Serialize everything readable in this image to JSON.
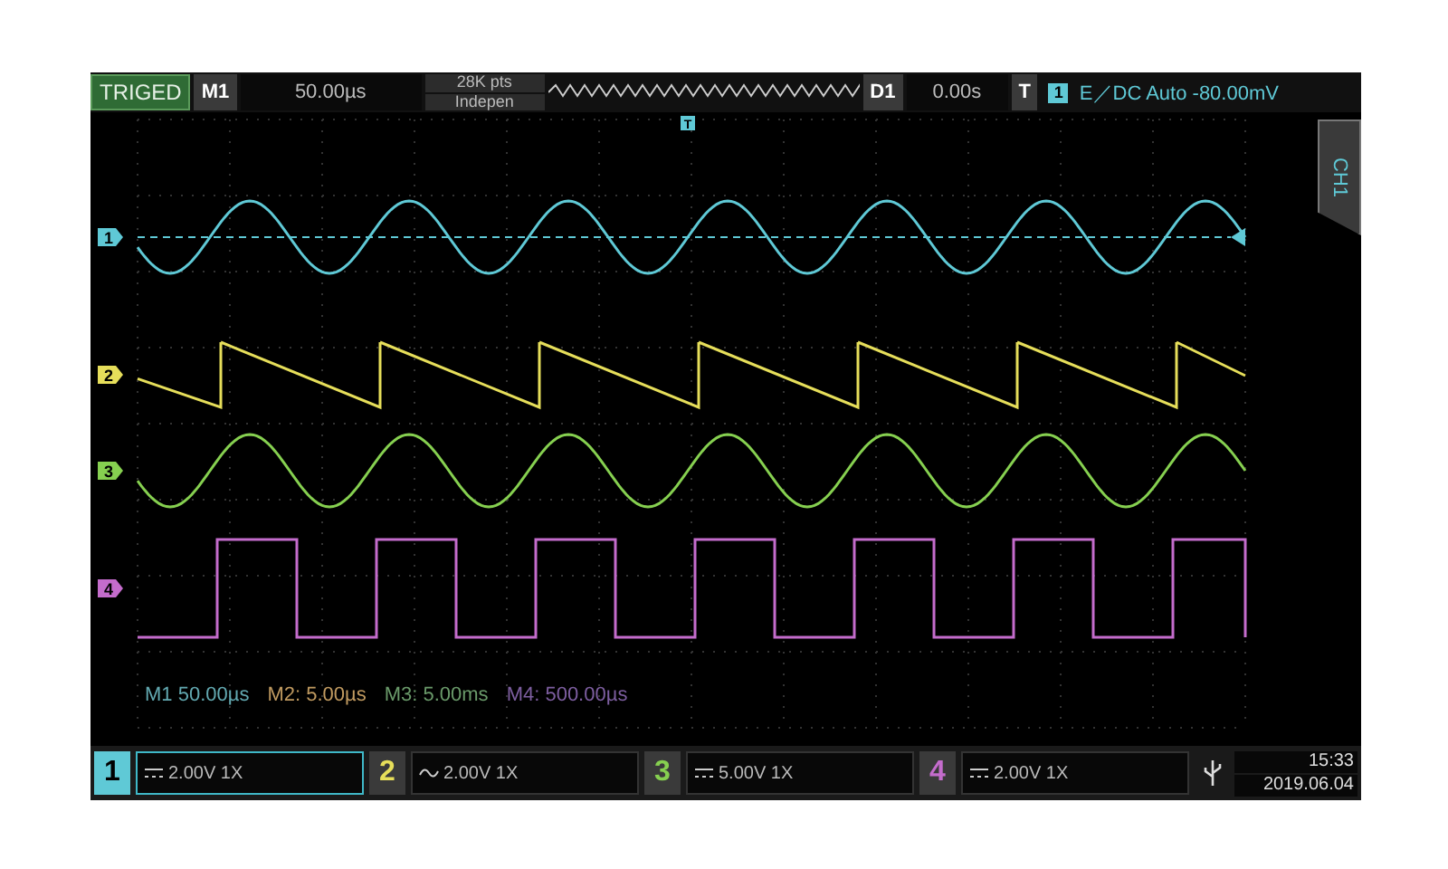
{
  "top_bar": {
    "trigger_status": "TRIGED",
    "memory_label": "M1",
    "timebase": "50.00µs",
    "points": "28K pts",
    "acquire_mode": "Indepen",
    "delay_label": "D1",
    "delay": "0.00s",
    "trigger_label": "T",
    "trigger_source": "1",
    "trigger_info": "E／DC Auto -80.00mV"
  },
  "trigger_position_marker": "T",
  "side_tab": {
    "label": "CH1"
  },
  "channels": [
    {
      "marker": "1",
      "kind": "sine",
      "color": "#5fc9d6",
      "trigger_level": true
    },
    {
      "marker": "2",
      "kind": "sawtooth",
      "color": "#e6de5a",
      "trigger_level": false
    },
    {
      "marker": "3",
      "kind": "sine",
      "color": "#86d050",
      "trigger_level": false
    },
    {
      "marker": "4",
      "kind": "square",
      "color": "#c46ccc",
      "trigger_level": false
    }
  ],
  "math_readouts": [
    {
      "text": "M1 50.00µs",
      "color": "#62a8b0"
    },
    {
      "text": "M2: 5.00µs",
      "color": "#c09a60"
    },
    {
      "text": "M3: 5.00ms",
      "color": "#6a9a6a"
    },
    {
      "text": "M4: 500.00µs",
      "color": "#7d5ea0"
    }
  ],
  "channel_bar": [
    {
      "number": "1",
      "kind": "dc",
      "setting": "2.00V 1X",
      "selected": true
    },
    {
      "number": "2",
      "kind": "ac",
      "setting": "2.00V 1X",
      "selected": false
    },
    {
      "number": "3",
      "kind": "dc",
      "setting": "5.00V 1X",
      "selected": false
    },
    {
      "number": "4",
      "kind": "dc",
      "setting": "2.00V 1X",
      "selected": false
    }
  ],
  "clock": {
    "time": "15:33",
    "date": "2019.06.04"
  }
}
